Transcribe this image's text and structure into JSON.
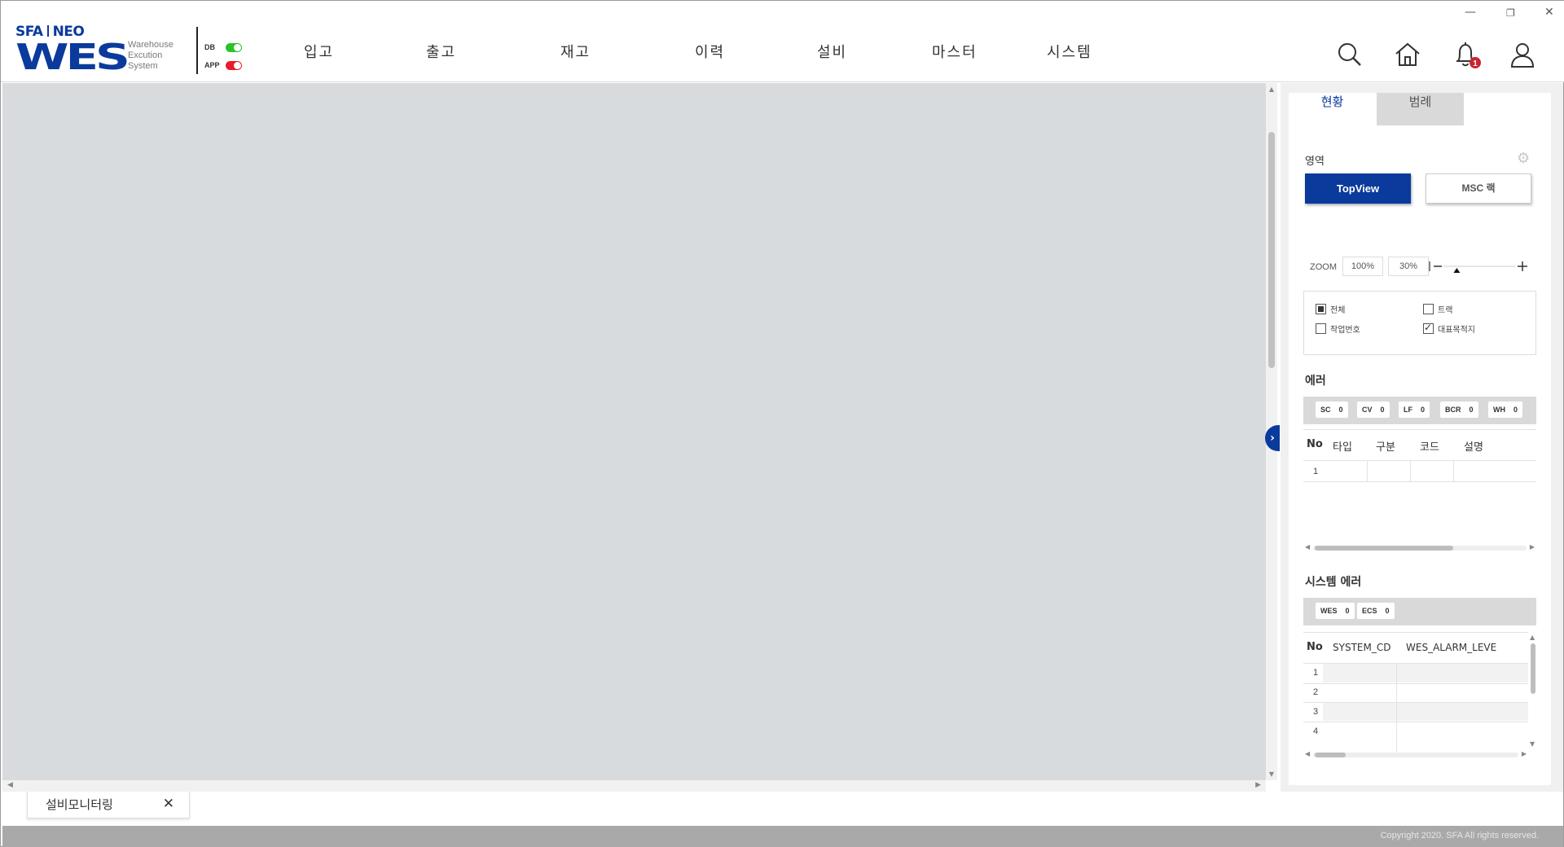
{
  "logo": {
    "brand": "SFA",
    "brand2": "NEO",
    "product": "WES",
    "sub1": "Warehouse",
    "sub2": "Excution",
    "sub3": "System"
  },
  "status": {
    "db_label": "DB",
    "db_color": "#29c229",
    "app_label": "APP",
    "app_color": "#e81b2a"
  },
  "menu": [
    "입고",
    "출고",
    "재고",
    "이력",
    "설비",
    "마스터",
    "시스템"
  ],
  "header_icons": [
    "search-icon",
    "home-icon",
    "bell-icon",
    "user-icon"
  ],
  "notification_count": "1",
  "window_controls": {
    "minimize": "—",
    "restore": "❐",
    "close": "✕"
  },
  "right_panel": {
    "tabs": [
      "현황",
      "범례"
    ],
    "area_title": "영역",
    "btn_topview": "TopView",
    "btn_msc": "MSC 랙",
    "zoom": {
      "label": "ZOOM",
      "reset": "100%",
      "current": "30%",
      "level_pct": 30
    },
    "checks": [
      {
        "label": "전체",
        "state": "partial"
      },
      {
        "label": "트랙",
        "state": "unchecked"
      },
      {
        "label": "작업번호",
        "state": "unchecked"
      },
      {
        "label": "대표목적지",
        "state": "checked"
      }
    ],
    "error_title": "에러",
    "error_badges": [
      {
        "name": "SC",
        "value": "0"
      },
      {
        "name": "CV",
        "value": "0"
      },
      {
        "name": "LF",
        "value": "0"
      },
      {
        "name": "BCR",
        "value": "0"
      },
      {
        "name": "WH",
        "value": "0"
      }
    ],
    "error_columns": [
      "No",
      "타입",
      "구분",
      "코드",
      "설명"
    ],
    "error_rows": [
      "1"
    ],
    "sys_error_title": "시스템 에러",
    "sys_badges": [
      {
        "name": "WES",
        "value": "0"
      },
      {
        "name": "ECS",
        "value": "0"
      }
    ],
    "sys_columns": [
      "No",
      "SYSTEM_CD",
      "WES_ALARM_LEVE"
    ],
    "sys_rows": [
      "1",
      "2",
      "3",
      "4"
    ]
  },
  "bottom_tab": {
    "label": "설비모니터링",
    "close": "✕"
  },
  "footer": {
    "copyright": "Copyright 2020. SFA All rights reserved."
  }
}
